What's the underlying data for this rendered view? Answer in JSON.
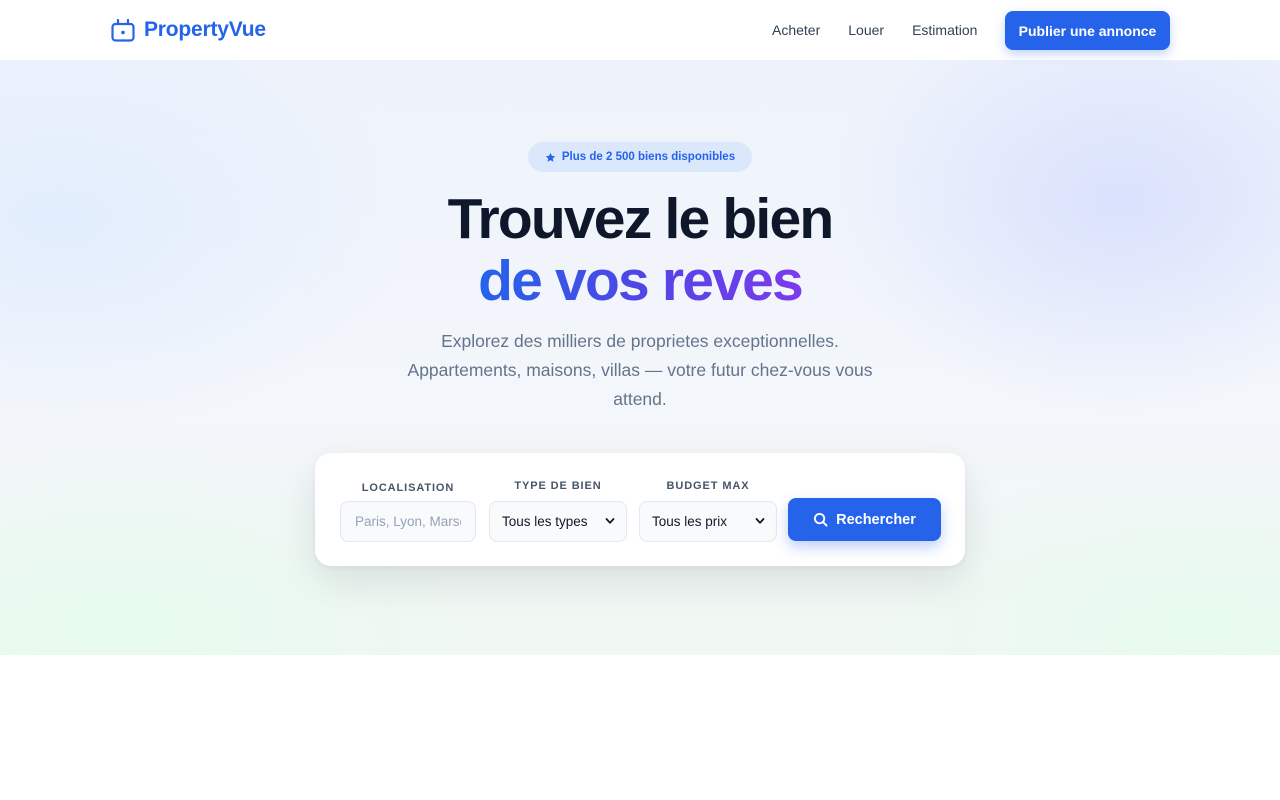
{
  "header": {
    "brand": "PropertyVue",
    "nav": [
      {
        "label": "Acheter"
      },
      {
        "label": "Louer"
      },
      {
        "label": "Estimation"
      }
    ],
    "cta_label": "Publier une annonce"
  },
  "hero": {
    "badge": {
      "icon": "star-icon",
      "text": "Plus de 2 500 biens disponibles"
    },
    "title_line1": "Trouvez le bien",
    "title_line2": "de vos reves",
    "subtitle": "Explorez des milliers de proprietes exceptionnelles. Appartements, maisons, villas — votre futur chez-vous vous attend."
  },
  "search": {
    "location_label": "LOCALISATION",
    "location_placeholder": "Paris, Lyon, Marseille...",
    "type_label": "TYPE DE BIEN",
    "type_selected": "Tous les types",
    "budget_label": "BUDGET MAX",
    "budget_selected": "Tous les prix",
    "button_label": "Rechercher"
  },
  "colors": {
    "primary": "#2563eb",
    "title_dark": "#0f172a",
    "gradient_start": "#2563eb",
    "gradient_end": "#7c3aed",
    "muted_text": "#64748b"
  }
}
